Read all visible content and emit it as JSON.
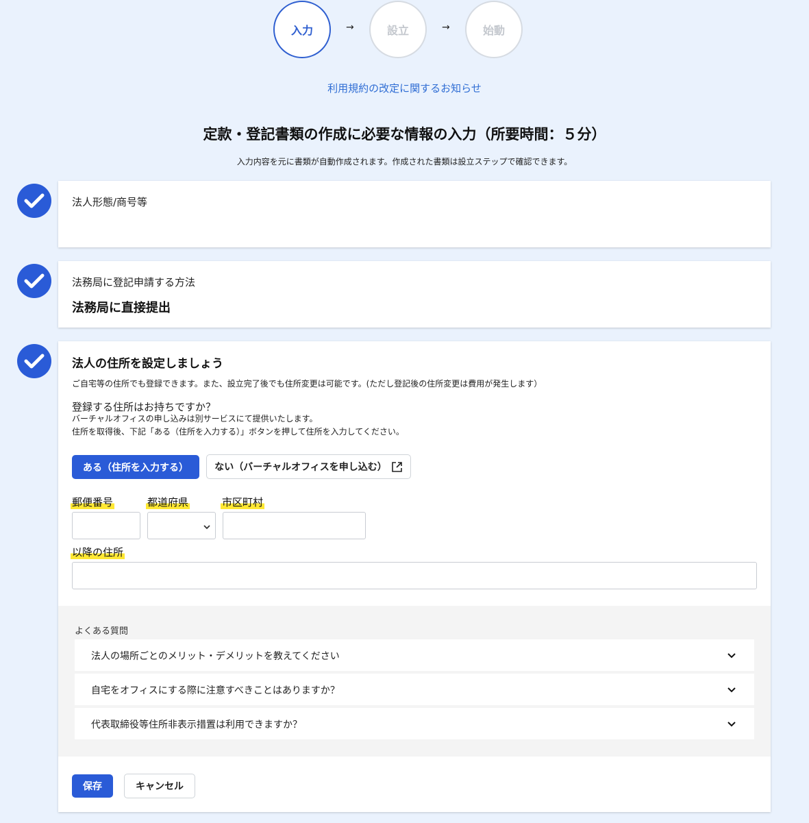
{
  "stepper": {
    "steps": [
      {
        "label": "入力",
        "active": true
      },
      {
        "label": "設立",
        "active": false
      },
      {
        "label": "始動",
        "active": false
      }
    ],
    "arrow": "→"
  },
  "notice_link": "利用規約の改定に関するお知らせ",
  "page": {
    "title": "定款・登記書類の作成に必要な情報の入力（所要時間：５分）",
    "subtitle": "入力内容を元に書類が自動作成されます。作成された書類は設立ステップで確認できます。"
  },
  "sections": {
    "corporate_form": {
      "label": "法人形態/商号等"
    },
    "filing_method": {
      "label": "法務局に登記申請する方法",
      "value": "法務局に直接提出"
    },
    "address": {
      "title": "法人の住所を設定しましょう",
      "description": "ご自宅等の住所でも登録できます。また、設立完了後でも住所変更は可能です。(ただし登記後の住所変更は費用が発生します）",
      "question": "登録する住所はお持ちですか？",
      "note1": "バーチャルオフィスの申し込みは別サービスにて提供いたします。",
      "note2": "住所を取得後、下記「ある（住所を入力する）」ボタンを押して住所を入力してください。",
      "btn_yes": "ある（住所を入力する）",
      "btn_no": "ない（バーチャルオフィスを申し込む）",
      "fields": {
        "postal": "郵便番号",
        "prefecture": "都道府県",
        "city": "市区町村",
        "rest": "以降の住所"
      }
    }
  },
  "faq": {
    "heading": "よくある質問",
    "items": [
      "法人の場所ごとのメリット・デメリットを教えてください",
      "自宅をオフィスにする際に注意すべきことはありますか？",
      "代表取締役等住所非表示措置は利用できますか？"
    ]
  },
  "actions": {
    "save": "保存",
    "cancel": "キャンセル"
  },
  "colors": {
    "primary": "#2a5bd7",
    "link": "#2f6dd4",
    "highlight": "#ffe833",
    "background": "#eaf2fd"
  }
}
